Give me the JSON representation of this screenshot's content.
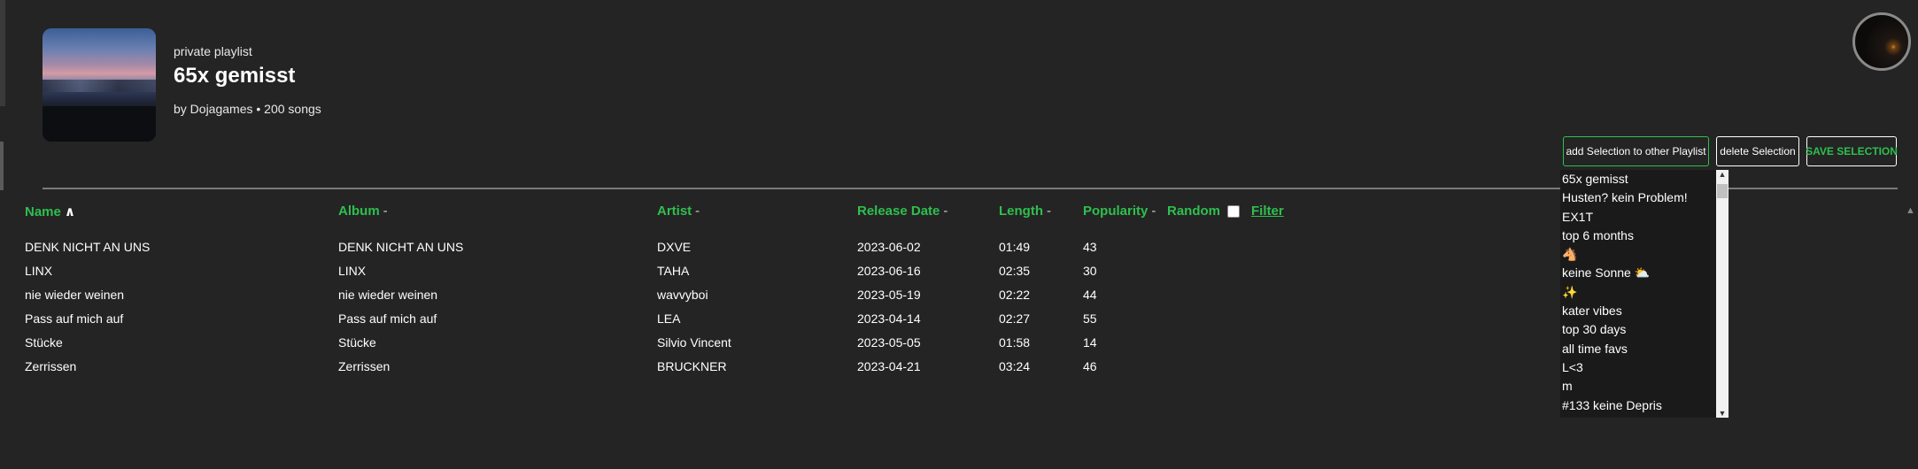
{
  "playlist": {
    "type_label": "private playlist",
    "title": "65x gemisst",
    "byline": "by Dojagames • 200 songs"
  },
  "actions": {
    "add_label": "add Selection to other Playlist",
    "delete_label": "delete Selection",
    "save_label": "SAVE SELECTION"
  },
  "table": {
    "headers": {
      "name": "Name",
      "name_sort": "∧",
      "album": "Album",
      "album_sort": "-",
      "artist": "Artist",
      "artist_sort": "-",
      "release": "Release Date",
      "release_sort": "-",
      "length": "Length",
      "length_sort": "-",
      "popularity": "Popularity",
      "popularity_sort": "-",
      "random": "Random",
      "filter": "Filter"
    },
    "rows": [
      {
        "name": "DENK NICHT AN UNS",
        "album": "DENK NICHT AN UNS",
        "artist": "DXVE",
        "release": "2023-06-02",
        "length": "01:49",
        "popularity": "43"
      },
      {
        "name": "LINX",
        "album": "LINX",
        "artist": "TAHA",
        "release": "2023-06-16",
        "length": "02:35",
        "popularity": "30"
      },
      {
        "name": "nie wieder weinen",
        "album": "nie wieder weinen",
        "artist": "wavvyboi",
        "release": "2023-05-19",
        "length": "02:22",
        "popularity": "44"
      },
      {
        "name": "Pass auf mich auf",
        "album": "Pass auf mich auf",
        "artist": "LEA",
        "release": "2023-04-14",
        "length": "02:27",
        "popularity": "55"
      },
      {
        "name": "Stücke",
        "album": "Stücke",
        "artist": "Silvio Vincent",
        "release": "2023-05-05",
        "length": "01:58",
        "popularity": "14"
      },
      {
        "name": "Zerrissen",
        "album": "Zerrissen",
        "artist": "BRUCKNER",
        "release": "2023-04-21",
        "length": "03:24",
        "popularity": "46"
      }
    ]
  },
  "playlist_select": {
    "options": [
      "65x gemisst",
      "Husten? kein Problem!",
      "EX1T",
      "top 6 months",
      "🐴",
      "keine Sonne ⛅",
      "✨",
      "kater vibes",
      "top 30 days",
      "all time favs",
      "L<3",
      "m",
      "#133 keine Depris"
    ]
  },
  "colors": {
    "background": "#242424",
    "accent_green": "#2fbf4f",
    "text": "#ffffff"
  },
  "icons": {
    "random_checkbox": "checkbox-unchecked",
    "scroll_up": "chevron-up-icon",
    "scroll_down": "chevron-down-icon"
  }
}
